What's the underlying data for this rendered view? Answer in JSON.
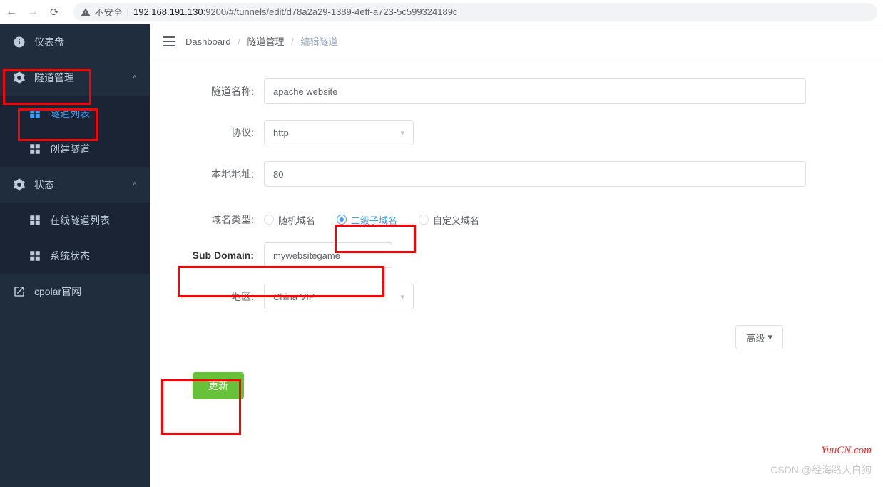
{
  "browser": {
    "insecure_label": "不安全",
    "url_host": "192.168.191.130",
    "url_path": ":9200/#/tunnels/edit/d78a2a29-1389-4eff-a723-5c599324189c"
  },
  "sidebar": {
    "dashboard": "仪表盘",
    "tunnel_mgmt": "隧道管理",
    "tunnel_list": "隧道列表",
    "create_tunnel": "创建隧道",
    "status": "状态",
    "online_list": "在线隧道列表",
    "system_status": "系统状态",
    "cpolar": "cpolar官网"
  },
  "breadcrumb": {
    "dashboard": "Dashboard",
    "tunnel_mgmt": "隧道管理",
    "edit_tunnel": "编辑隧道"
  },
  "form": {
    "name_label": "隧道名称:",
    "name_value": "apache website",
    "protocol_label": "协议:",
    "protocol_value": "http",
    "local_addr_label": "本地地址:",
    "local_addr_value": "80",
    "domain_type_label": "域名类型:",
    "domain_random": "随机域名",
    "domain_sub": "二级子域名",
    "domain_custom": "自定义域名",
    "subdomain_label": "Sub Domain:",
    "subdomain_value": "mywebsitegame",
    "region_label": "地区:",
    "region_value": "China VIP",
    "advanced": "高级",
    "submit": "更新"
  },
  "watermarks": {
    "site": "YuuCN.com",
    "csdn": "CSDN @经海路大白狗"
  }
}
